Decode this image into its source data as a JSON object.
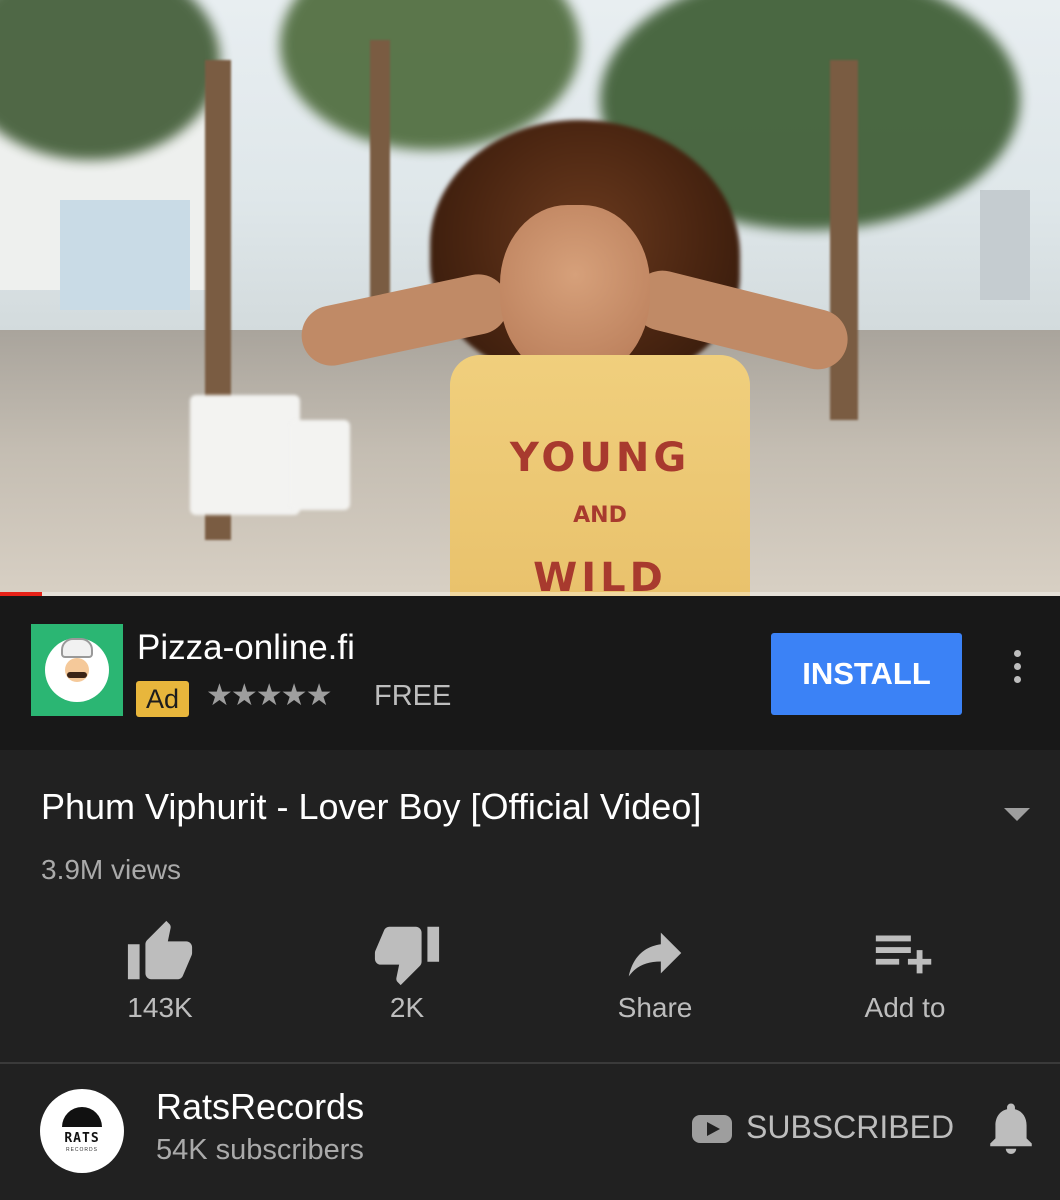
{
  "player": {
    "shirt_text": [
      "YOUNG",
      "AND",
      "WILD"
    ],
    "progress_fraction": 0.04
  },
  "ad": {
    "title": "Pizza-online.fi",
    "badge": "Ad",
    "stars": "★★★★★",
    "rating": 5,
    "price": "FREE",
    "install_label": "INSTALL"
  },
  "video": {
    "title": "Phum Viphurit - Lover Boy [Official Video]",
    "views": "3.9M views"
  },
  "actions": {
    "like": "143K",
    "dislike": "2K",
    "share": "Share",
    "add_to": "Add to"
  },
  "channel": {
    "name": "RatsRecords",
    "subscribers": "54K subscribers",
    "avatar_text": "RATS",
    "avatar_subtext": "RECORDS",
    "subscribe_label": "SUBSCRIBED"
  },
  "colors": {
    "background": "#212121",
    "ad_background": "#181818",
    "install_button": "#3b82f6",
    "ad_badge": "#e8b63c",
    "progress": "#e62117",
    "ad_logo_bg": "#2bb673"
  }
}
